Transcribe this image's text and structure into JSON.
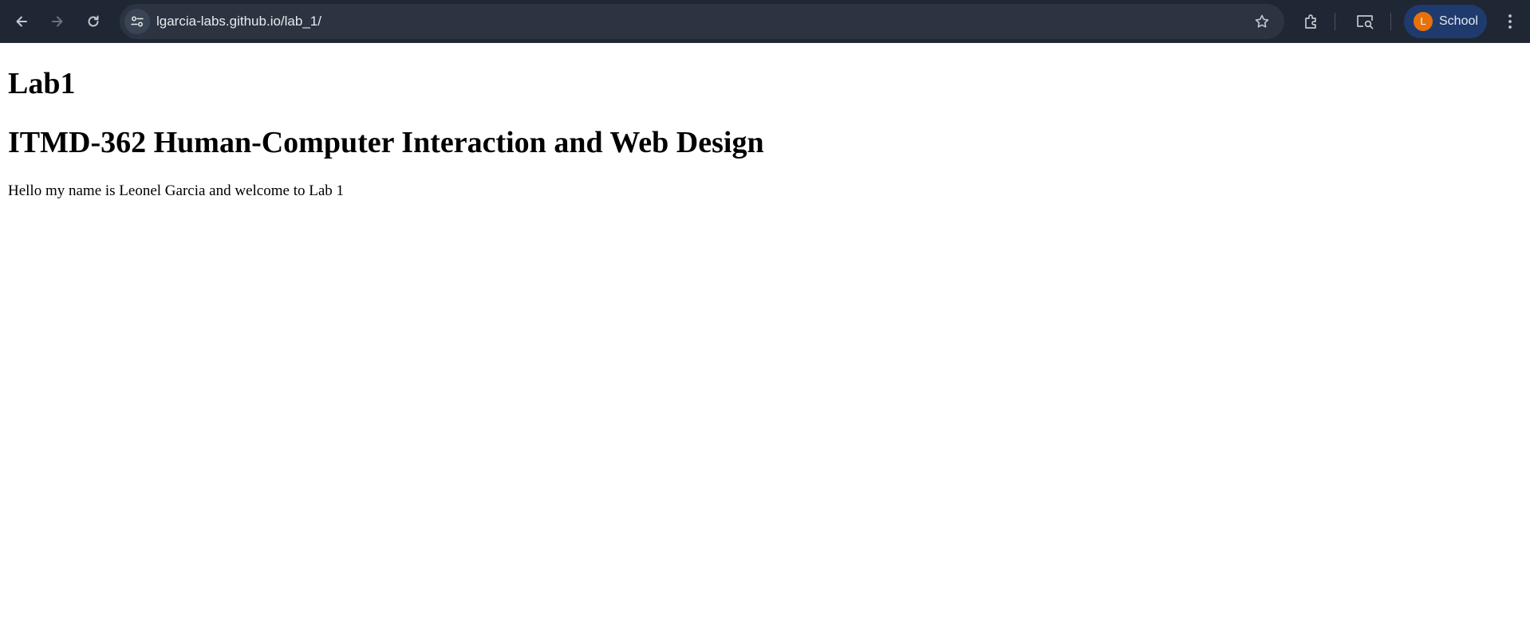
{
  "browser": {
    "url": "lgarcia-labs.github.io/lab_1/",
    "profile_initial": "L",
    "profile_label": "School",
    "icons": {
      "back": "arrow-left-icon",
      "forward": "arrow-right-icon",
      "reload": "reload-icon",
      "site_info": "tune-icon",
      "bookmark": "star-icon",
      "extensions": "puzzle-icon",
      "search_tab": "tab-search-icon",
      "menu": "kebab-menu-icon"
    },
    "colors": {
      "toolbar": "#1f2734",
      "omnibox": "#2c3442",
      "profile_chip": "#1f3b6e",
      "avatar": "#e8710a"
    }
  },
  "page": {
    "title": "Lab1",
    "course_heading": "ITMD-362 Human-Computer Interaction and Web Design",
    "intro": "Hello my name is Leonel Garcia and welcome to Lab 1"
  }
}
